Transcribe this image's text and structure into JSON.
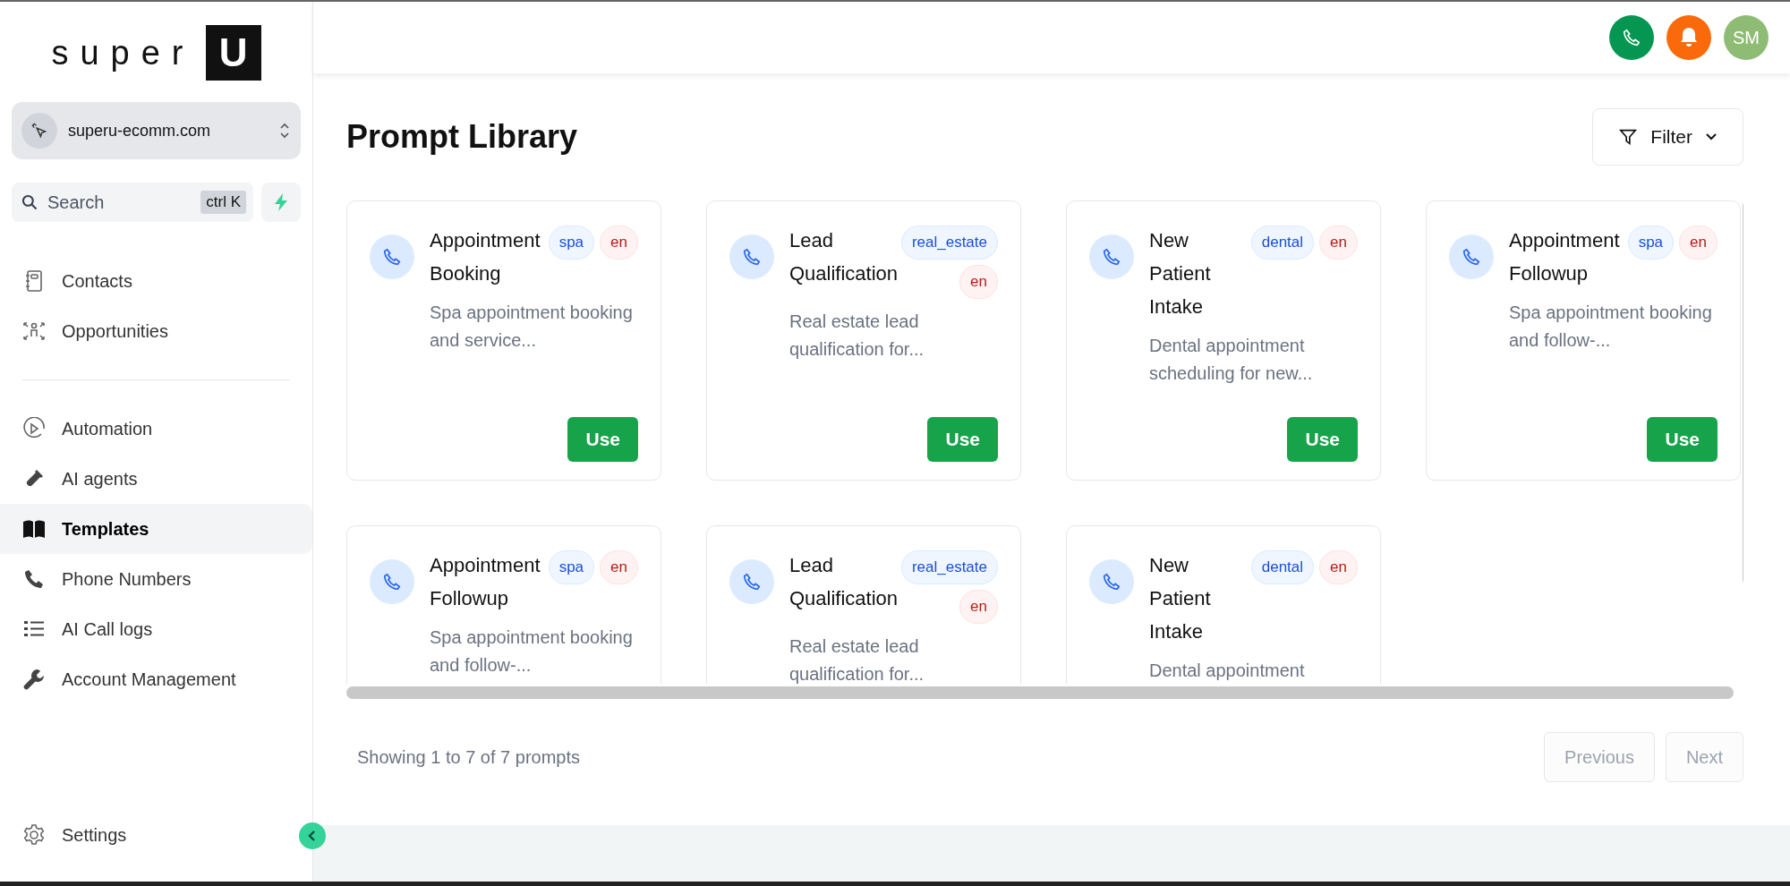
{
  "sidebar": {
    "logo": {
      "text": "super",
      "mark": "U"
    },
    "workspace": {
      "name": "superu-ecomm.com"
    },
    "search": {
      "placeholder": "Search",
      "shortcut": "ctrl K"
    },
    "nav_groups": [
      [
        {
          "label": "Contacts",
          "kind": "contacts",
          "selected": false
        },
        {
          "label": "Opportunities",
          "kind": "opportunities",
          "selected": false
        }
      ],
      [
        {
          "label": "Automation",
          "kind": "automation",
          "selected": false
        },
        {
          "label": "AI agents",
          "kind": "agents",
          "selected": false
        },
        {
          "label": "Templates",
          "kind": "templates",
          "selected": true
        },
        {
          "label": "Phone Numbers",
          "kind": "phone",
          "selected": false
        },
        {
          "label": "AI Call logs",
          "kind": "logs",
          "selected": false
        },
        {
          "label": "Account Management",
          "kind": "account",
          "selected": false
        }
      ]
    ],
    "settings": {
      "label": "Settings"
    }
  },
  "header": {
    "actions": [
      {
        "kind": "call"
      },
      {
        "kind": "notifications"
      },
      {
        "kind": "avatar",
        "text": "SM"
      }
    ]
  },
  "main": {
    "title": "Prompt Library",
    "filter": {
      "label": "Filter"
    },
    "prompts": [
      {
        "title": "Appointment Booking",
        "tags": [
          {
            "label": "spa",
            "kind": "category"
          },
          {
            "label": "en",
            "kind": "language"
          }
        ],
        "description": "Spa appointment booking and service...",
        "action": "Use"
      },
      {
        "title": "Lead Qualification",
        "tags": [
          {
            "label": "real_estate",
            "kind": "category"
          },
          {
            "label": "en",
            "kind": "language"
          }
        ],
        "description": "Real estate lead qualification for...",
        "action": "Use"
      },
      {
        "title": "New Patient Intake",
        "tags": [
          {
            "label": "dental",
            "kind": "category"
          },
          {
            "label": "en",
            "kind": "language"
          }
        ],
        "description": "Dental appointment scheduling for new...",
        "action": "Use"
      },
      {
        "title": "Appointment Followup",
        "tags": [
          {
            "label": "spa",
            "kind": "category"
          },
          {
            "label": "en",
            "kind": "language"
          }
        ],
        "description": "Spa appointment booking and follow-...",
        "action": "Use"
      },
      {
        "title": "Appointment Followup",
        "tags": [
          {
            "label": "spa",
            "kind": "category"
          },
          {
            "label": "en",
            "kind": "language"
          }
        ],
        "description": "Spa appointment booking and follow-..."
      },
      {
        "title": "Lead Qualification",
        "tags": [
          {
            "label": "real_estate",
            "kind": "category"
          },
          {
            "label": "en",
            "kind": "language"
          }
        ],
        "description": "Real estate lead qualification for..."
      },
      {
        "title": "New Patient Intake",
        "tags": [
          {
            "label": "dental",
            "kind": "category"
          },
          {
            "label": "en",
            "kind": "language"
          }
        ],
        "description": "Dental appointment"
      }
    ],
    "footer": {
      "summary": "Showing 1 to 7 of 7 prompts",
      "buttons": [
        {
          "label": "Previous",
          "disabled": true
        },
        {
          "label": "Next",
          "disabled": true
        }
      ]
    }
  }
}
